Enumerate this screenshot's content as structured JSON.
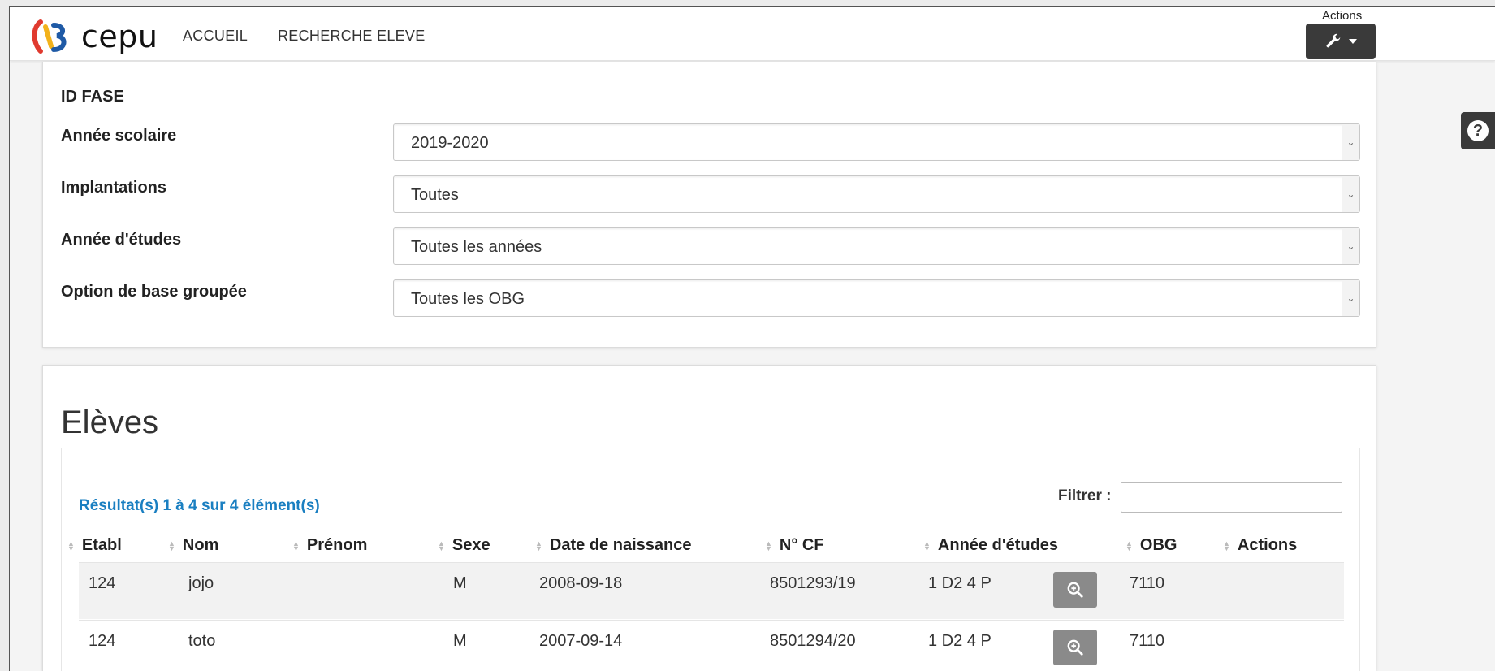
{
  "brand": {
    "name": "cepu"
  },
  "nav": {
    "items": [
      "ACCUEIL",
      "RECHERCHE ELEVE"
    ]
  },
  "header_actions": {
    "label": "Actions",
    "icon": "wrench-icon"
  },
  "help": {
    "icon": "question-circle-icon",
    "glyph": "?"
  },
  "form": {
    "title": "ID FASE",
    "fields": [
      {
        "label": "Année scolaire",
        "value": "2019-2020"
      },
      {
        "label": "Implantations",
        "value": "Toutes"
      },
      {
        "label": "Année d'études",
        "value": "Toutes les années"
      },
      {
        "label": "Option de base groupée",
        "value": "Toutes les OBG"
      }
    ]
  },
  "students": {
    "title": "Elèves",
    "result_count": "Résultat(s) 1 à 4 sur 4 élément(s)",
    "filter_label": "Filtrer :",
    "filter_value": "",
    "columns": [
      "Etabl",
      "Nom",
      "Prénom",
      "Sexe",
      "Date de naissance",
      "N° CF",
      "Année d'études",
      "OBG",
      "Actions"
    ],
    "rows": [
      {
        "etabl": "124",
        "nom": "jojo",
        "prenom": "",
        "sexe": "M",
        "date": "2008-09-18",
        "cf": "8501293/19",
        "annee": "1 D2 4 P",
        "obg": "7110"
      },
      {
        "etabl": "124",
        "nom": "toto",
        "prenom": "",
        "sexe": "M",
        "date": "2007-09-14",
        "cf": "8501294/20",
        "annee": "1 D2 4 P",
        "obg": "7110"
      }
    ]
  },
  "colors": {
    "accent": "#1a7fc1",
    "dark_button": "#3a3a3a",
    "view_button": "#8a8a8a"
  }
}
